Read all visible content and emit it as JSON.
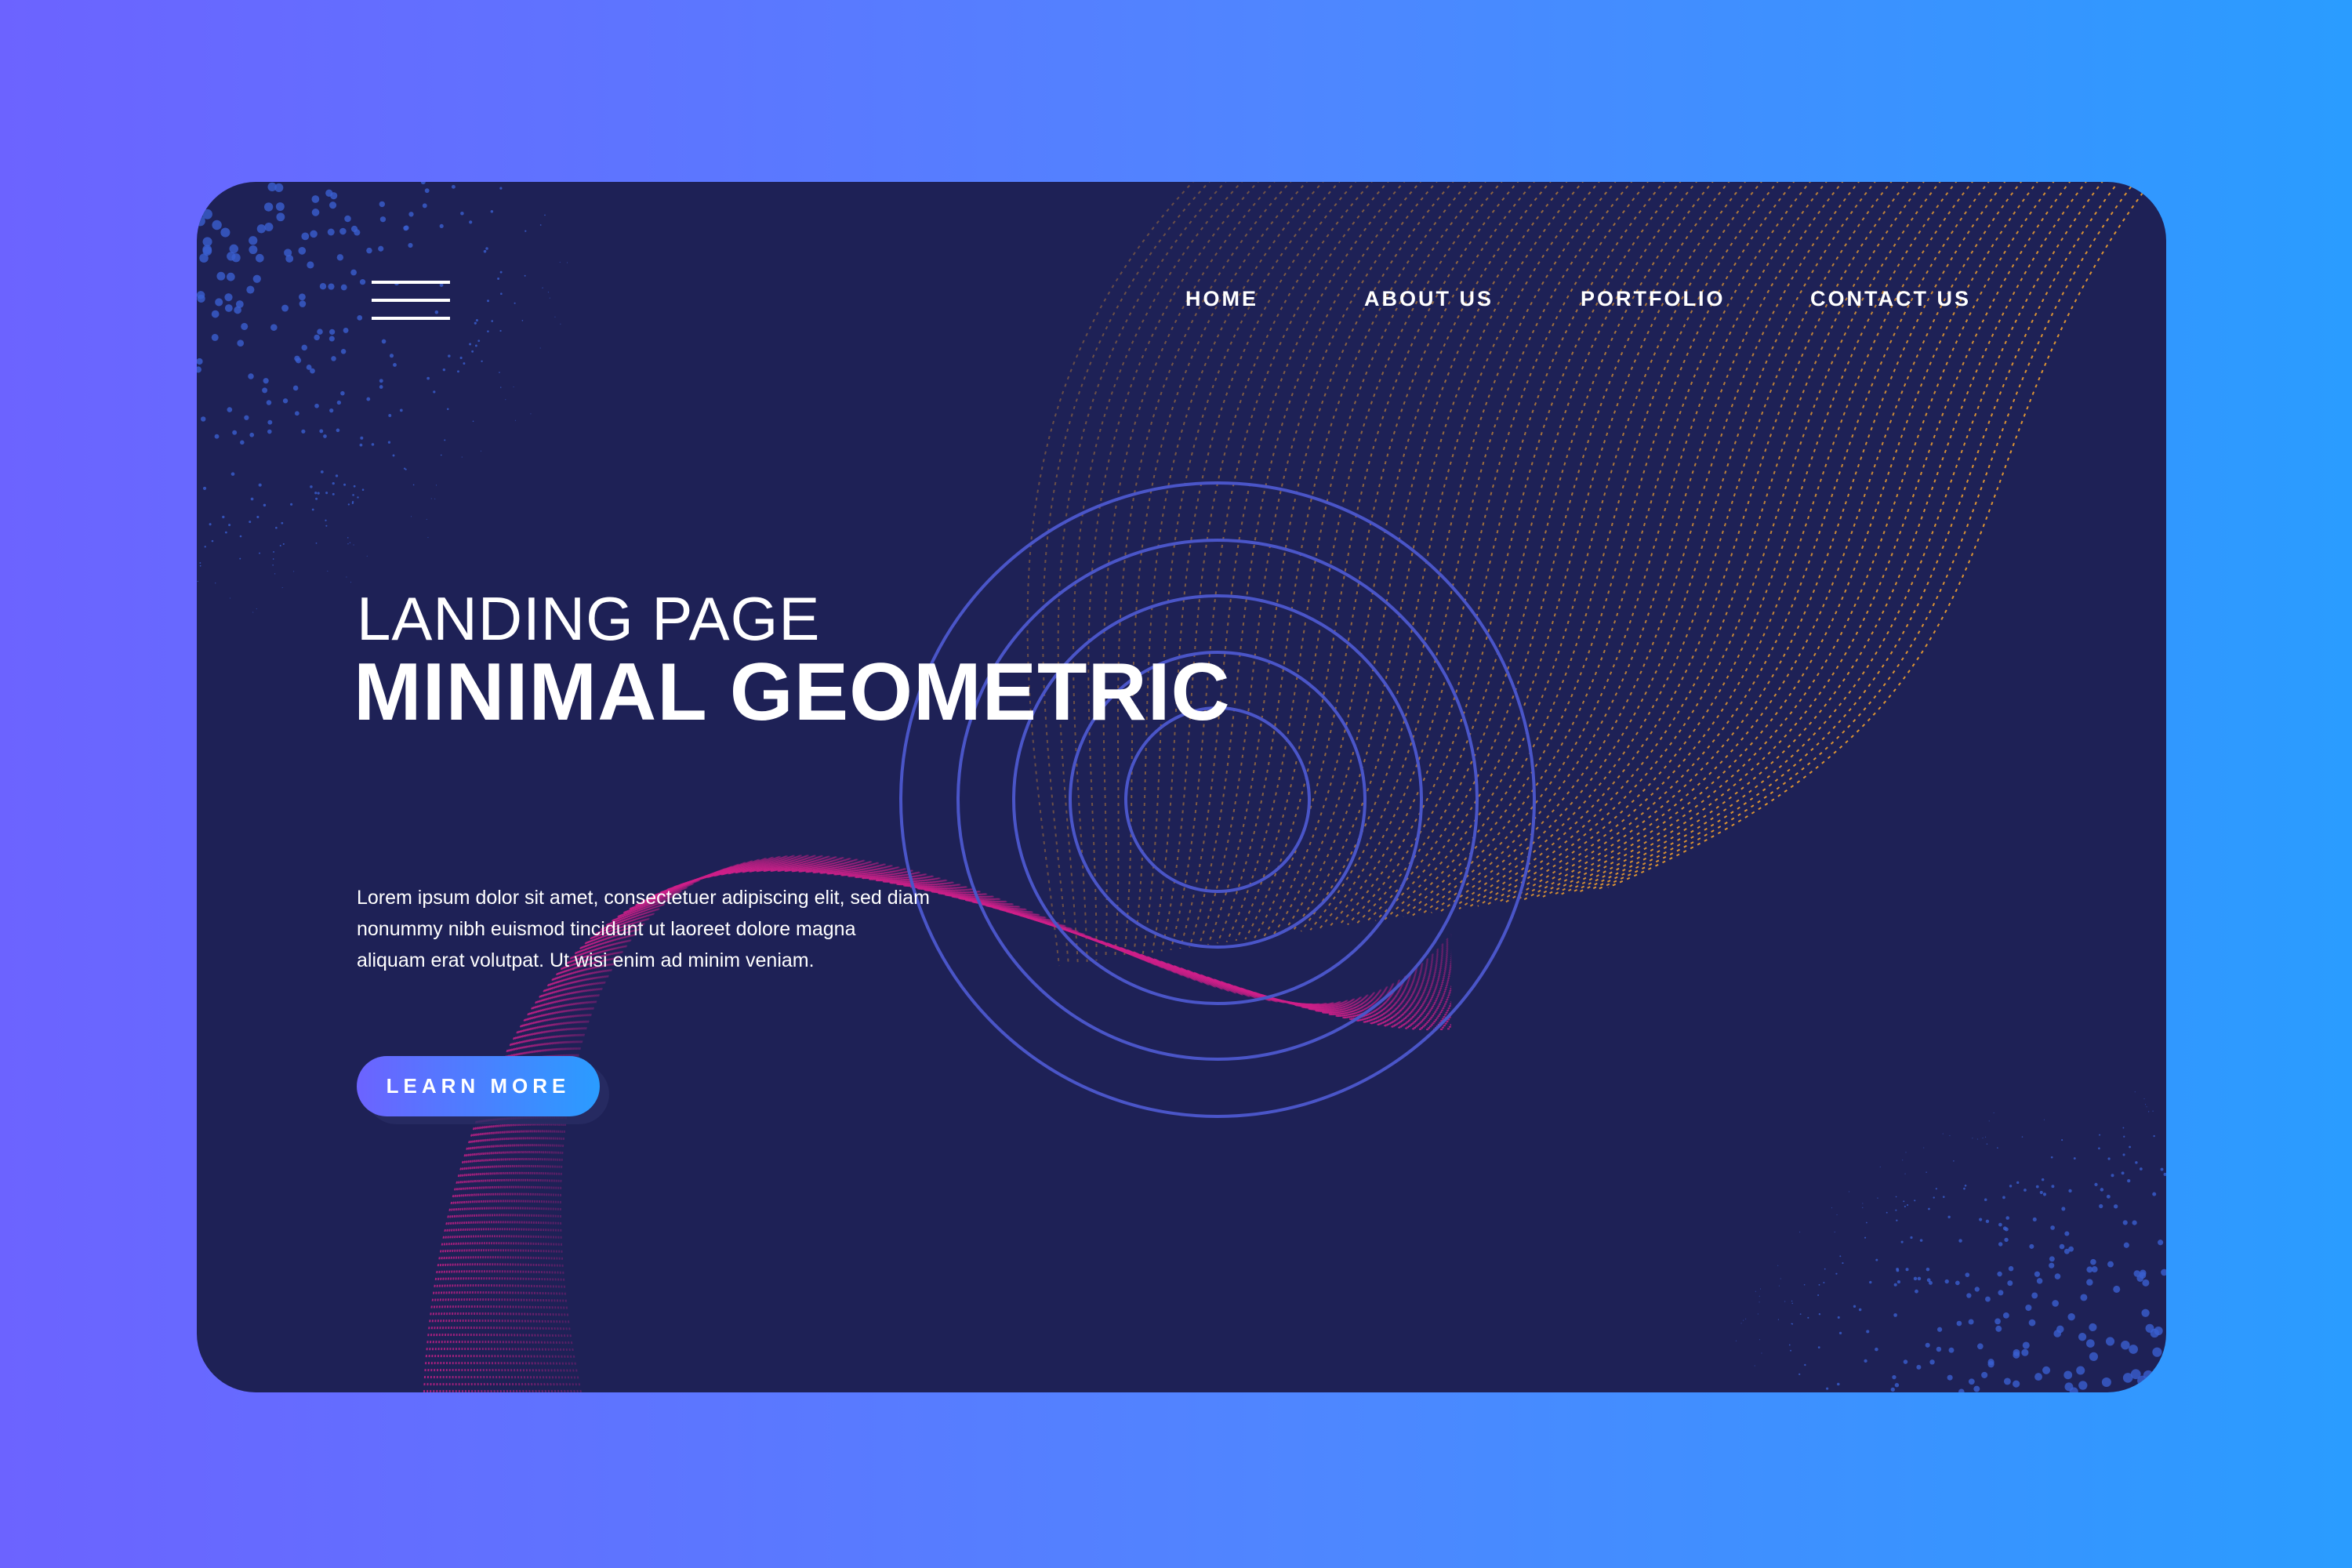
{
  "nav": {
    "menu_icon": "hamburger-menu-icon",
    "items": [
      {
        "label": "HOME"
      },
      {
        "label": "ABOUT US"
      },
      {
        "label": "PORTFOLIO"
      },
      {
        "label": "CONTACT US"
      }
    ]
  },
  "hero": {
    "subtitle": "LANDING PAGE",
    "title": "MINIMAL GEOMETRIC",
    "paragraph_lines": [
      "Lorem ipsum dolor sit amet, consectetuer adipiscing elit, sed diam",
      "nonummy nibh euismod tincidunt ut laoreet dolore magna",
      "aliquam erat volutpat. Ut wisi enim ad minim veniam."
    ],
    "button_label": "LEARN MORE"
  },
  "colors": {
    "card_bg": "#1e2156",
    "gradient_start": "#6c63ff",
    "gradient_end": "#2a9cff",
    "wave_orange": "#f0a030",
    "wave_magenta": "#d0208a",
    "rings": "#4a55c8"
  }
}
